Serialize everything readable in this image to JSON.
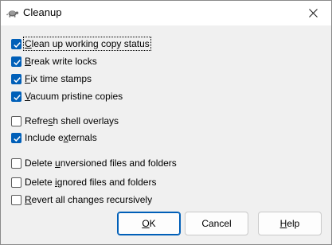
{
  "window": {
    "title": "Cleanup",
    "app_icon": "tortoise-icon",
    "close_icon": "close-icon"
  },
  "options": [
    {
      "label": "Clean up working copy status",
      "mnemonic": "C",
      "checked": true,
      "focused": true
    },
    {
      "label": "Break write locks",
      "mnemonic": "B",
      "checked": true,
      "focused": false
    },
    {
      "label": "Fix time stamps",
      "mnemonic": "F",
      "checked": true,
      "focused": false
    },
    {
      "label": "Vacuum pristine copies",
      "mnemonic": "V",
      "checked": true,
      "focused": false
    },
    {
      "label": "Refresh shell overlays",
      "mnemonic": "s",
      "checked": false,
      "focused": false
    },
    {
      "label": "Include externals",
      "mnemonic": "x",
      "checked": true,
      "focused": false
    },
    {
      "label": "Delete unversioned files and folders",
      "mnemonic": "u",
      "checked": false,
      "focused": false
    },
    {
      "label": "Delete ignored files and folders",
      "mnemonic": "i",
      "checked": false,
      "focused": false
    },
    {
      "label": "Revert all changes recursively",
      "mnemonic": "R",
      "checked": false,
      "focused": false
    }
  ],
  "buttons": {
    "ok": {
      "label": "OK",
      "mnemonic": "O"
    },
    "cancel": {
      "label": "Cancel"
    },
    "help": {
      "label": "Help",
      "mnemonic": "H"
    }
  },
  "colors": {
    "accent": "#005fb8",
    "dialog_bg": "#f0f0f0",
    "titlebar_bg": "#ffffff"
  }
}
